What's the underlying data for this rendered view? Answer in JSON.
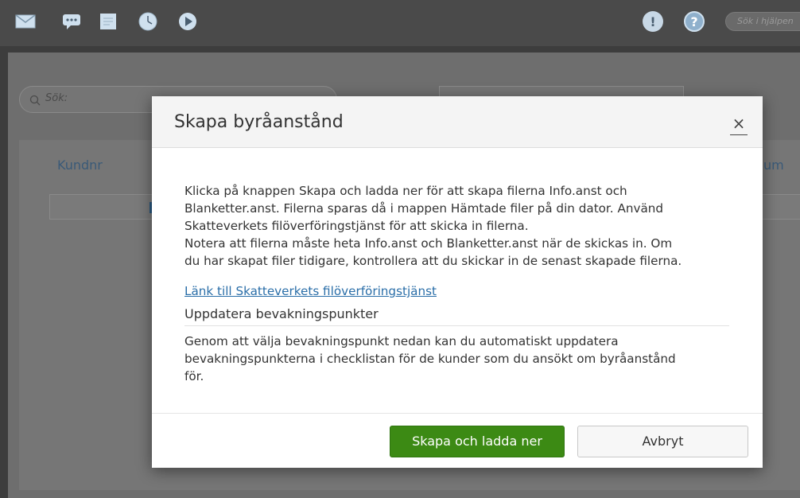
{
  "toolbar": {
    "icons": [
      "mail-icon",
      "chat-icon",
      "notes-icon",
      "clock-icon",
      "play-icon"
    ],
    "right_icons": [
      "alert-icon",
      "help-icon"
    ],
    "alert_glyph": "!",
    "help_glyph": "?",
    "help_search_placeholder": "Sök i hjälpen"
  },
  "background": {
    "search_label": "Sök:",
    "columns": [
      "Kundnr",
      "um"
    ]
  },
  "modal": {
    "title": "Skapa byråanstånd",
    "close_glyph": "×",
    "paragraph1_lines": [
      "Klicka på knappen Skapa och ladda ner för att skapa filerna Info.anst och",
      "Blanketter.anst. Filerna sparas då i mappen Hämtade filer på din dator. Använd",
      "Skatteverkets filöverföringstjänst för att skicka in filerna.",
      "Notera att filerna måste heta Info.anst och Blanketter.anst när de skickas in. Om",
      "du har skapat filer tidigare, kontrollera att du skickar in de senast skapade filerna."
    ],
    "link_text": "Länk till Skatteverkets filöverföringstjänst",
    "section_title": "Uppdatera bevakningspunkter",
    "paragraph2_lines": [
      "Genom att välja bevakningspunkt nedan kan du automatiskt uppdatera",
      "bevakningspunkterna i checklistan för de kunder som du ansökt om byråanstånd",
      "för."
    ],
    "primary_button": "Skapa och ladda ner",
    "secondary_button": "Avbryt"
  },
  "colors": {
    "primary_green": "#3c8a14",
    "link_blue": "#2a6ea8",
    "toolbar_bg": "#4a4a4a"
  }
}
